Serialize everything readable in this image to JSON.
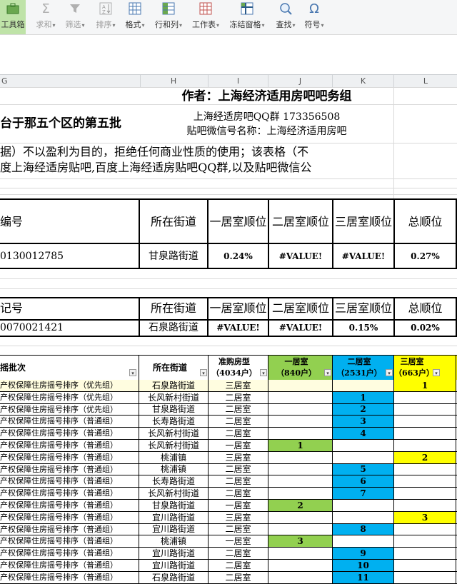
{
  "toolbar": {
    "items": [
      {
        "label": "工具箱",
        "icon": "toolbox-icon"
      },
      {
        "label": "求和",
        "icon": "sum-icon"
      },
      {
        "label": "筛选",
        "icon": "filter-icon"
      },
      {
        "label": "排序",
        "icon": "sort-icon"
      },
      {
        "label": "格式",
        "icon": "format-icon"
      },
      {
        "label": "行和列",
        "icon": "row-col-icon"
      },
      {
        "label": "工作表",
        "icon": "sheet-icon"
      },
      {
        "label": "冻结窗格",
        "icon": "freeze-icon"
      },
      {
        "label": "查找",
        "icon": "find-icon"
      },
      {
        "label": "符号",
        "icon": "symbol-icon"
      }
    ]
  },
  "columns": [
    "G",
    "H",
    "I",
    "J",
    "K",
    "L"
  ],
  "header": {
    "author": "作者：上海经济适用房吧吧务组",
    "batch_fragment": "台于那五个区的第五批",
    "qq_group": "上海经适房吧QQ群 173356508",
    "wechat": "贴吧微信号名称：上海经济适用房吧",
    "disclaimer_1": "据）不以盈利为目的，拒绝任何商业性质的使用；该表格（不",
    "disclaimer_2": "度上海经适房贴吧,百度上海经适房贴吧QQ群,以及贴吧微信公"
  },
  "box1": {
    "col_id": "编号",
    "col_street": "所在街道",
    "col_r1": "一居室顺位",
    "col_r2": "二居室顺位",
    "col_r3": "三居室顺位",
    "col_total": "总顺位",
    "id": "0130012785",
    "street": "甘泉路街道",
    "r1": "0.24%",
    "r2": "#VALUE!",
    "r3": "#VALUE!",
    "total": "0.27%"
  },
  "box2": {
    "col_id": "记号",
    "col_street": "所在街道",
    "col_r1": "一居室顺位",
    "col_r2": "二居室顺位",
    "col_r3": "三居室顺位",
    "col_total": "总顺位",
    "id": "0070021421",
    "street": "石泉路街道",
    "r1": "#VALUE!",
    "r2": "#VALUE!",
    "r3": "0.15%",
    "total": "0.02%"
  },
  "table": {
    "col_batch": "摇批次",
    "col_street": "所在街道",
    "col_type_1": "准购房型",
    "col_type_2": "（4034户）",
    "col_r1_1": "一居室",
    "col_r1_2": "（840户）",
    "col_r2_1": "二居室",
    "col_r2_2": "（2531户）",
    "col_r3_1": "三居室",
    "col_r3_2": "（663户）",
    "rows": [
      {
        "batch": "产权保障住房摇号排序（优先组）",
        "street": "石泉路街道",
        "type": "三居室",
        "r1": "",
        "r2": "",
        "r3": "1"
      },
      {
        "batch": "产权保障住房摇号排序（优先组）",
        "street": "长风新村街道",
        "type": "二居室",
        "r1": "",
        "r2": "1",
        "r3": ""
      },
      {
        "batch": "产权保障住房摇号排序（优先组）",
        "street": "甘泉路街道",
        "type": "二居室",
        "r1": "",
        "r2": "2",
        "r3": ""
      },
      {
        "batch": "产权保障住房摇号排序（普通组）",
        "street": "长寿路街道",
        "type": "二居室",
        "r1": "",
        "r2": "3",
        "r3": ""
      },
      {
        "batch": "产权保障住房摇号排序（普通组）",
        "street": "长风新村街道",
        "type": "二居室",
        "r1": "",
        "r2": "4",
        "r3": ""
      },
      {
        "batch": "产权保障住房摇号排序（普通组）",
        "street": "长风新村街道",
        "type": "一居室",
        "r1": "1",
        "r2": "",
        "r3": ""
      },
      {
        "batch": "产权保障住房摇号排序（普通组）",
        "street": "桃浦镇",
        "type": "三居室",
        "r1": "",
        "r2": "",
        "r3": "2"
      },
      {
        "batch": "产权保障住房摇号排序（普通组）",
        "street": "桃浦镇",
        "type": "二居室",
        "r1": "",
        "r2": "5",
        "r3": ""
      },
      {
        "batch": "产权保障住房摇号排序（普通组）",
        "street": "长寿路街道",
        "type": "二居室",
        "r1": "",
        "r2": "6",
        "r3": ""
      },
      {
        "batch": "产权保障住房摇号排序（普通组）",
        "street": "长风新村街道",
        "type": "二居室",
        "r1": "",
        "r2": "7",
        "r3": ""
      },
      {
        "batch": "产权保障住房摇号排序（普通组）",
        "street": "甘泉路街道",
        "type": "一居室",
        "r1": "2",
        "r2": "",
        "r3": ""
      },
      {
        "batch": "产权保障住房摇号排序（普通组）",
        "street": "宜川路街道",
        "type": "三居室",
        "r1": "",
        "r2": "",
        "r3": "3"
      },
      {
        "batch": "产权保障住房摇号排序（普通组）",
        "street": "宜川路街道",
        "type": "二居室",
        "r1": "",
        "r2": "8",
        "r3": ""
      },
      {
        "batch": "产权保障住房摇号排序（普通组）",
        "street": "桃浦镇",
        "type": "一居室",
        "r1": "3",
        "r2": "",
        "r3": ""
      },
      {
        "batch": "产权保障住房摇号排序（普通组）",
        "street": "宜川路街道",
        "type": "二居室",
        "r1": "",
        "r2": "9",
        "r3": ""
      },
      {
        "batch": "产权保障住房摇号排序（普通组）",
        "street": "宜川路街道",
        "type": "二居室",
        "r1": "",
        "r2": "10",
        "r3": ""
      },
      {
        "batch": "产权保障住房摇号排序（普通组）",
        "street": "石泉路街道",
        "type": "二居室",
        "r1": "",
        "r2": "11",
        "r3": ""
      }
    ]
  },
  "colors": {
    "one_room": "#92d050",
    "two_room": "#00b0f0",
    "three_room": "#ffff00"
  }
}
